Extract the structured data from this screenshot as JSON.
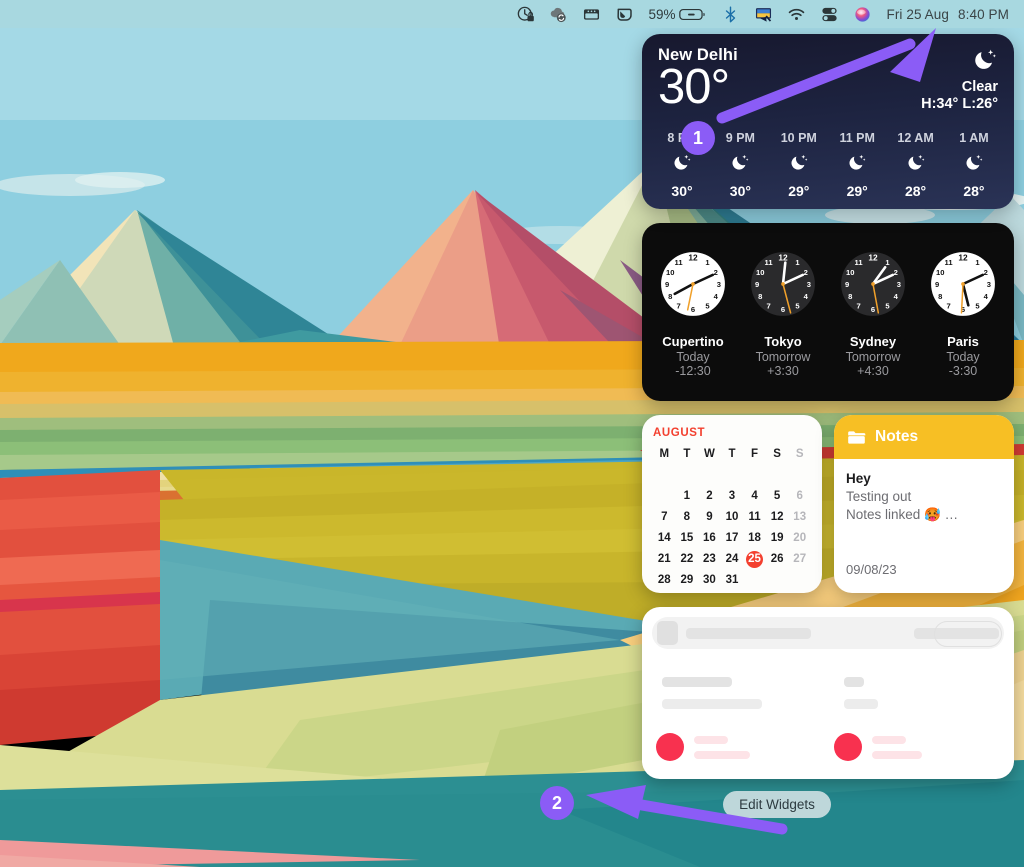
{
  "menubar": {
    "icons": [
      {
        "name": "vpn-lock-icon",
        "label": "VPN"
      },
      {
        "name": "cloud-sync-icon",
        "label": "Sync"
      },
      {
        "name": "window-app-icon",
        "label": "Window Manager"
      },
      {
        "name": "screenshot-tool-icon",
        "label": "Screenshot Tool"
      }
    ],
    "battery_percent": "59%",
    "battery_icon": "battery-icon",
    "bluetooth_icon": "bluetooth-icon",
    "display_icon": "display-sharing-icon",
    "wifi_icon": "wifi-icon",
    "control_center_icon": "control-center-icon",
    "siri_icon": "siri-icon",
    "date": "Fri 25 Aug",
    "time": "8:40 PM"
  },
  "weather": {
    "city": "New Delhi",
    "temperature": "30°",
    "condition": "Clear",
    "high_low": "H:34° L:26°",
    "condition_icon": "moon-stars-icon",
    "hourly": [
      {
        "hour": "8 PM",
        "icon": "moon-stars-icon",
        "temp": "30°"
      },
      {
        "hour": "9 PM",
        "icon": "moon-stars-icon",
        "temp": "30°"
      },
      {
        "hour": "10 PM",
        "icon": "moon-stars-icon",
        "temp": "29°"
      },
      {
        "hour": "11 PM",
        "icon": "moon-stars-icon",
        "temp": "29°"
      },
      {
        "hour": "12 AM",
        "icon": "moon-stars-icon",
        "temp": "28°"
      },
      {
        "hour": "1 AM",
        "icon": "moon-stars-icon",
        "temp": "28°"
      }
    ]
  },
  "clocks": [
    {
      "city": "Cupertino",
      "day": "Today",
      "offset": "-12:30",
      "theme": "light",
      "hour": 8,
      "minute": 10,
      "second": 32
    },
    {
      "city": "Tokyo",
      "day": "Tomorrow",
      "offset": "+3:30",
      "theme": "dark",
      "hour": 12,
      "minute": 10,
      "second": 28
    },
    {
      "city": "Sydney",
      "day": "Tomorrow",
      "offset": "+4:30",
      "theme": "dark",
      "hour": 1,
      "minute": 10,
      "second": 27
    },
    {
      "city": "Paris",
      "day": "Today",
      "offset": "-3:30",
      "theme": "light",
      "hour": 5,
      "minute": 10,
      "second": 28
    }
  ],
  "calendar": {
    "month": "AUGUST",
    "weekdays": [
      "M",
      "T",
      "W",
      "T",
      "F",
      "S",
      "S"
    ],
    "cells": [
      {
        "d": "",
        "state": "blank"
      },
      {
        "d": "",
        "state": "blank"
      },
      {
        "d": "",
        "state": "blank"
      },
      {
        "d": "",
        "state": "blank"
      },
      {
        "d": "",
        "state": "blank"
      },
      {
        "d": "",
        "state": "blank"
      },
      {
        "d": "",
        "state": "blank"
      },
      {
        "d": "",
        "state": "blank"
      },
      {
        "d": "1",
        "state": "normal"
      },
      {
        "d": "2",
        "state": "normal"
      },
      {
        "d": "3",
        "state": "normal"
      },
      {
        "d": "4",
        "state": "normal"
      },
      {
        "d": "5",
        "state": "normal"
      },
      {
        "d": "6",
        "state": "dim"
      },
      {
        "d": "7",
        "state": "normal"
      },
      {
        "d": "8",
        "state": "normal"
      },
      {
        "d": "9",
        "state": "normal"
      },
      {
        "d": "10",
        "state": "normal"
      },
      {
        "d": "11",
        "state": "normal"
      },
      {
        "d": "12",
        "state": "normal"
      },
      {
        "d": "13",
        "state": "dim"
      },
      {
        "d": "14",
        "state": "normal"
      },
      {
        "d": "15",
        "state": "normal"
      },
      {
        "d": "16",
        "state": "normal"
      },
      {
        "d": "17",
        "state": "normal"
      },
      {
        "d": "18",
        "state": "normal"
      },
      {
        "d": "19",
        "state": "normal"
      },
      {
        "d": "20",
        "state": "dim"
      },
      {
        "d": "21",
        "state": "normal"
      },
      {
        "d": "22",
        "state": "normal"
      },
      {
        "d": "23",
        "state": "normal"
      },
      {
        "d": "24",
        "state": "normal"
      },
      {
        "d": "25",
        "state": "today"
      },
      {
        "d": "26",
        "state": "normal"
      },
      {
        "d": "27",
        "state": "dim"
      },
      {
        "d": "28",
        "state": "normal"
      },
      {
        "d": "29",
        "state": "normal"
      },
      {
        "d": "30",
        "state": "normal"
      },
      {
        "d": "31",
        "state": "normal"
      },
      {
        "d": "",
        "state": "blank"
      },
      {
        "d": "",
        "state": "blank"
      },
      {
        "d": "",
        "state": "blank"
      }
    ],
    "accent_color": "#f3402f"
  },
  "notes": {
    "app_title": "Notes",
    "folder_icon": "folder-icon",
    "note_title": "Hey",
    "note_preview_line1": "Testing out",
    "note_preview_line2": "Notes linked 🥵 …",
    "note_date": "09/08/23",
    "header_color": "#f7bf24"
  },
  "placeholder_widget": {
    "name": "loading-placeholder-widget",
    "dot_color": "#f8314f"
  },
  "footer": {
    "edit_widgets_label": "Edit Widgets"
  },
  "annotations": [
    {
      "id": "1",
      "label": "1",
      "color": "#8b5cf6",
      "points_to": "weather-widget"
    },
    {
      "id": "2",
      "label": "2",
      "color": "#8b5cf6",
      "points_to": "edit-widgets-button"
    }
  ]
}
